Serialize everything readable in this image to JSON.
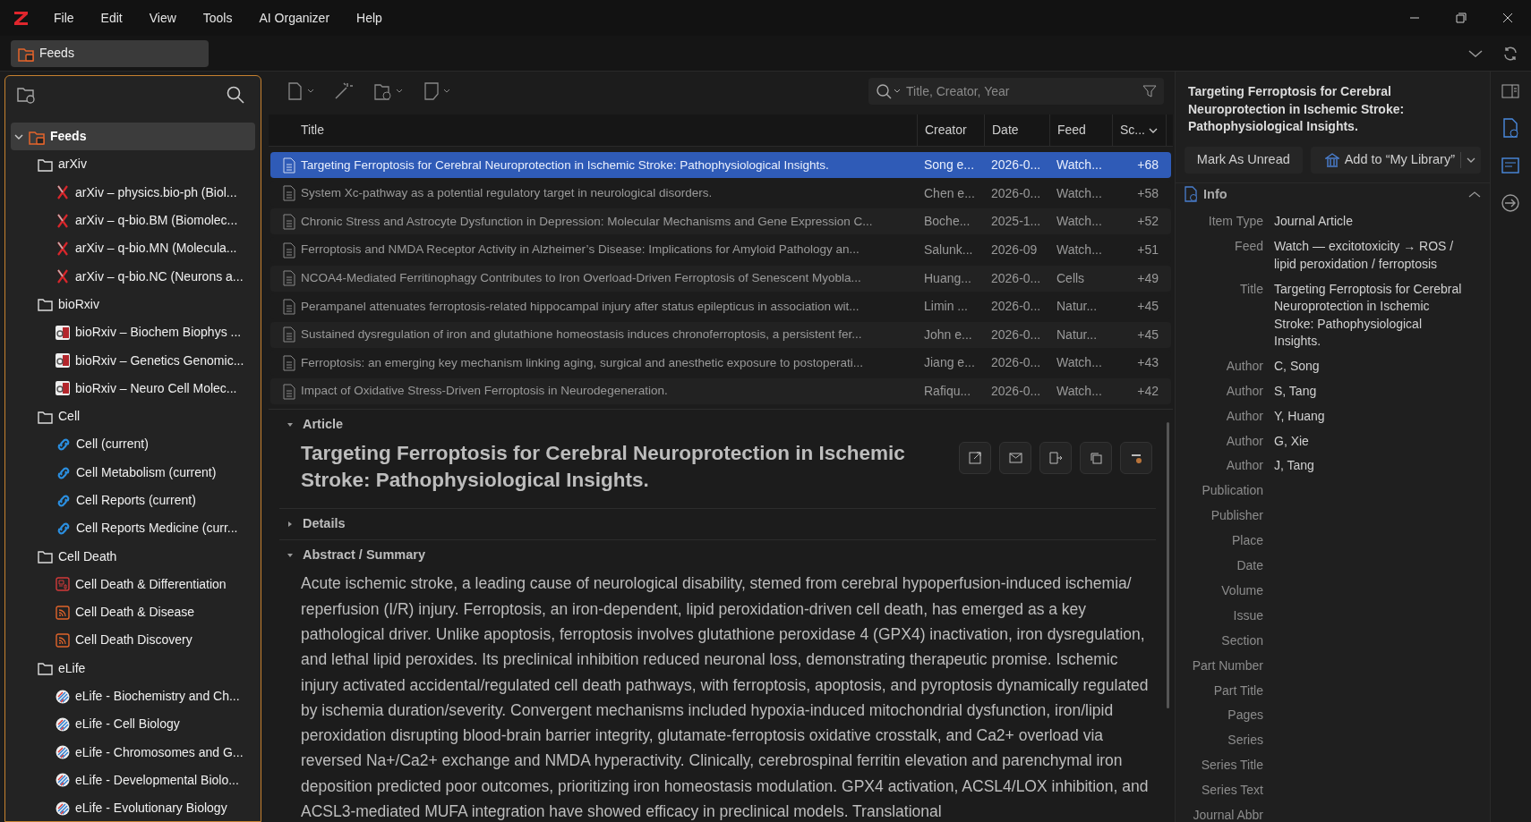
{
  "menu": [
    "File",
    "Edit",
    "View",
    "Tools",
    "AI Organizer",
    "Help"
  ],
  "tab": {
    "label": "Feeds"
  },
  "tree": [
    {
      "label": "Feeds",
      "kind": "root",
      "expanded": true,
      "selected": true,
      "children": [
        {
          "label": "arXiv",
          "kind": "folder",
          "selected": false,
          "children": [
            {
              "label": "arXiv – physics.bio-ph (Biol...",
              "kind": "arxiv",
              "selected": false
            },
            {
              "label": "arXiv – q-bio.BM (Biomolec...",
              "kind": "arxiv",
              "selected": false
            },
            {
              "label": "arXiv – q-bio.MN (Molecula...",
              "kind": "arxiv",
              "selected": false
            },
            {
              "label": "arXiv – q-bio.NC (Neurons a...",
              "kind": "arxiv",
              "selected": false
            }
          ]
        },
        {
          "label": "bioRxiv",
          "kind": "folder",
          "selected": false,
          "children": [
            {
              "label": "bioRxiv – Biochem Biophys ...",
              "kind": "biorxiv",
              "selected": false
            },
            {
              "label": "bioRxiv – Genetics Genomic...",
              "kind": "biorxiv",
              "selected": false
            },
            {
              "label": "bioRxiv – Neuro Cell Molec...",
              "kind": "biorxiv",
              "selected": false
            }
          ]
        },
        {
          "label": "Cell",
          "kind": "folder",
          "selected": false,
          "children": [
            {
              "label": "Cell (current)",
              "kind": "cell",
              "selected": false
            },
            {
              "label": "Cell Metabolism (current)",
              "kind": "cell",
              "selected": false
            },
            {
              "label": "Cell Reports (current)",
              "kind": "cell",
              "selected": false
            },
            {
              "label": "Cell Reports Medicine (curr...",
              "kind": "cell",
              "selected": false
            }
          ]
        },
        {
          "label": "Cell Death",
          "kind": "folder",
          "selected": false,
          "children": [
            {
              "label": "Cell Death & Differentiation",
              "kind": "journal",
              "selected": false
            },
            {
              "label": "Cell Death & Disease",
              "kind": "rss",
              "selected": false
            },
            {
              "label": "Cell Death Discovery",
              "kind": "rss",
              "selected": false
            }
          ]
        },
        {
          "label": "eLife",
          "kind": "folder",
          "selected": false,
          "children": [
            {
              "label": "eLife - Biochemistry and Ch...",
              "kind": "elife",
              "selected": false
            },
            {
              "label": "eLife - Cell Biology",
              "kind": "elife",
              "selected": false
            },
            {
              "label": "eLife - Chromosomes and G...",
              "kind": "elife",
              "selected": false
            },
            {
              "label": "eLife - Developmental Biolo...",
              "kind": "elife",
              "selected": false
            },
            {
              "label": "eLife - Evolutionary Biology",
              "kind": "elife",
              "selected": false
            }
          ]
        }
      ]
    }
  ],
  "search": {
    "placeholder": "Title, Creator, Year"
  },
  "table": {
    "columns": [
      "Title",
      "Creator",
      "Date",
      "Feed",
      "Sc..."
    ],
    "rows": [
      {
        "title": "Targeting Ferroptosis for Cerebral Neuroprotection in Ischemic Stroke: Pathophysiological Insights.",
        "creator": "Song e...",
        "date": "2026-0...",
        "feed": "Watch...",
        "score": "+68",
        "selected": true
      },
      {
        "title": "System Xc-pathway as a potential regulatory target in neurological disorders.",
        "creator": "Chen e...",
        "date": "2026-0...",
        "feed": "Watch...",
        "score": "+58",
        "selected": false
      },
      {
        "title": "Chronic Stress and Astrocyte Dysfunction in Depression: Molecular Mechanisms and Gene Expression C...",
        "creator": "Boche...",
        "date": "2025-1...",
        "feed": "Watch...",
        "score": "+52",
        "selected": false
      },
      {
        "title": "Ferroptosis and NMDA Receptor Activity in Alzheimer’s Disease: Implications for Amyloid Pathology an...",
        "creator": "Salunk...",
        "date": "2026-09",
        "feed": "Watch...",
        "score": "+51",
        "selected": false
      },
      {
        "title": "NCOA4-Mediated Ferritinophagy Contributes to Iron Overload-Driven Ferroptosis of Senescent Myobla...",
        "creator": "Huang...",
        "date": "2026-0...",
        "feed": "Cells",
        "score": "+49",
        "selected": false
      },
      {
        "title": "Perampanel attenuates ferroptosis-related hippocampal injury after status epilepticus in association wit...",
        "creator": "Limin ...",
        "date": "2026-0...",
        "feed": "Natur...",
        "score": "+45",
        "selected": false
      },
      {
        "title": "Sustained dysregulation of iron and glutathione homeostasis induces chronoferroptosis, a persistent fer...",
        "creator": "John e...",
        "date": "2026-0...",
        "feed": "Natur...",
        "score": "+45",
        "selected": false
      },
      {
        "title": "Ferroptosis: an emerging key mechanism linking aging, surgical and anesthetic exposure to postoperati...",
        "creator": "Jiang e...",
        "date": "2026-0...",
        "feed": "Watch...",
        "score": "+43",
        "selected": false
      },
      {
        "title": "Impact of Oxidative Stress-Driven Ferroptosis in Neurodegeneration.",
        "creator": "Rafiqu...",
        "date": "2026-0...",
        "feed": "Watch...",
        "score": "+42",
        "selected": false
      }
    ]
  },
  "article": {
    "sections": [
      {
        "label": "Article",
        "expanded": true,
        "kind": "title",
        "text": "Targeting Ferroptosis for Cerebral Neuroprotection in Ischemic Stroke: Pathophysiological Insights."
      },
      {
        "label": "Details",
        "expanded": false,
        "kind": "details"
      },
      {
        "label": "Abstract / Summary",
        "expanded": true,
        "kind": "abstract",
        "text": "Acute ischemic stroke, a leading cause of neurological disability, stemed from cerebral hypoperfusion-induced ischemia/ reperfusion (I/R) injury. Ferroptosis, an iron-dependent, lipid peroxidation-driven cell death, has emerged as a key pathological driver. Unlike apoptosis, ferroptosis involves glutathione peroxidase 4 (GPX4) inactivation, iron dysregulation, and lethal lipid peroxides. Its preclinical inhibition reduced neuronal loss, demonstrating therapeutic promise. Ischemic injury activated accidental/regulated cell death pathways, with ferroptosis, apoptosis, and pyroptosis dynamically regulated by ischemia duration/severity. Convergent mechanisms included hypoxia-induced mitochondrial dysfunction, iron/lipid peroxidation disrupting blood-brain barrier integrity, glutamate-ferroptosis oxidative crosstalk, and Ca2+ overload via reversed Na+/Ca2+ exchange and NMDA hyperactivity. Clinically, cerebrospinal ferritin elevation and parenchymal iron deposition predicted poor outcomes, prioritizing iron homeostasis modulation. GPX4 activation, ACSL4/LOX inhibition, and ACSL3-mediated MUFA integration have showed efficacy in preclinical models. Translational"
      }
    ]
  },
  "pane": {
    "title": "Targeting Ferroptosis for Cerebral Neuroprotection in Ischemic Stroke: Pathophysiological Insights.",
    "buttons": [
      "Mark As Unread",
      "Add to “My Library”"
    ],
    "info": {
      "label": "Info",
      "expanded": true,
      "fields": [
        {
          "label": "Item Type",
          "value": "Journal Article"
        },
        {
          "label": "Feed",
          "value": "Watch — excitotoxicity → ROS / lipid peroxidation / ferroptosis"
        },
        {
          "label": "Title",
          "value": "Targeting Ferroptosis for Cerebral Neuroprotection in Ischemic Stroke: Pathophysiological Insights."
        },
        {
          "label": "Author",
          "value": "C, Song"
        },
        {
          "label": "Author",
          "value": "S, Tang"
        },
        {
          "label": "Author",
          "value": "Y, Huang"
        },
        {
          "label": "Author",
          "value": "G, Xie"
        },
        {
          "label": "Author",
          "value": "J, Tang"
        },
        {
          "label": "Publication"
        },
        {
          "label": "Publisher"
        },
        {
          "label": "Place"
        },
        {
          "label": "Date"
        },
        {
          "label": "Volume"
        },
        {
          "label": "Issue"
        },
        {
          "label": "Section"
        },
        {
          "label": "Part Number"
        },
        {
          "label": "Part Title"
        },
        {
          "label": "Pages"
        },
        {
          "label": "Series"
        },
        {
          "label": "Series Title"
        },
        {
          "label": "Series Text"
        },
        {
          "label": "Journal Abbr"
        }
      ]
    }
  }
}
